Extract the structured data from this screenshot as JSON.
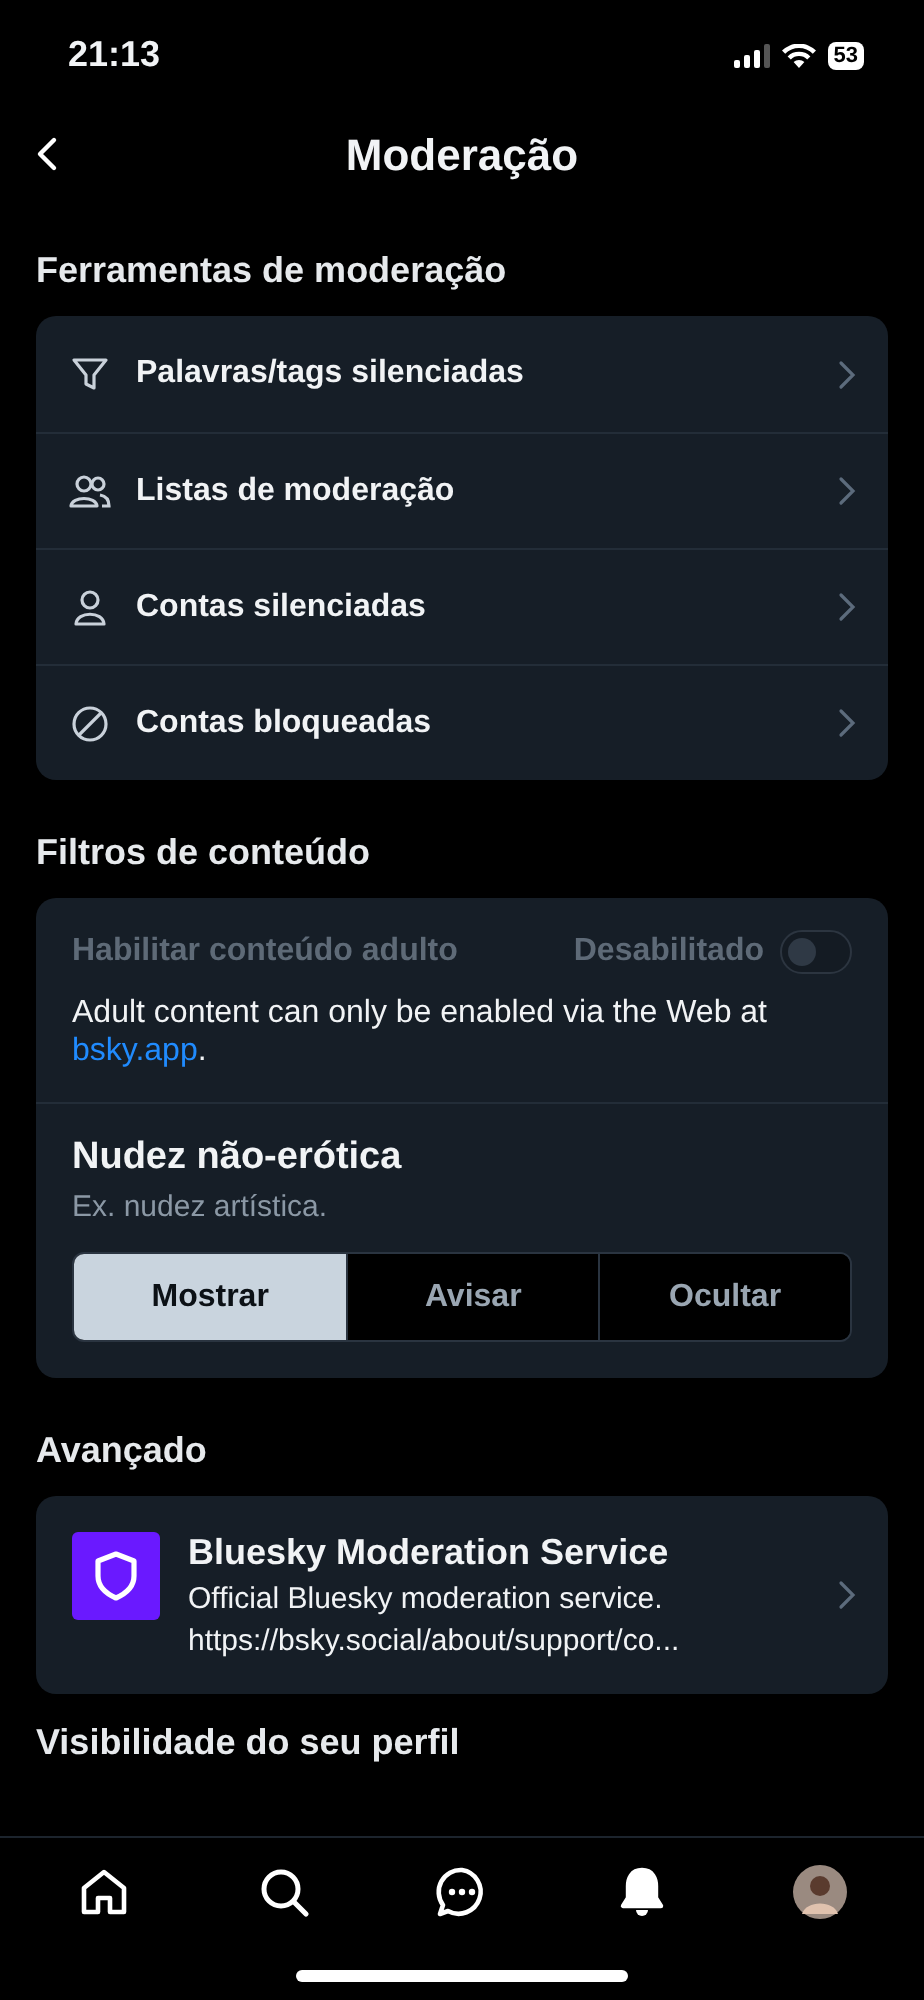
{
  "status_bar": {
    "time": "21:13",
    "battery": "53"
  },
  "header": {
    "title": "Moderação"
  },
  "tools": {
    "heading": "Ferramentas de moderação",
    "items": [
      {
        "kind": "filter",
        "label": "Palavras/tags silenciadas"
      },
      {
        "kind": "people",
        "label": "Listas de moderação"
      },
      {
        "kind": "person",
        "label": "Contas silenciadas"
      },
      {
        "kind": "blocked",
        "label": "Contas bloqueadas"
      }
    ]
  },
  "content_filters": {
    "heading": "Filtros de conteúdo",
    "adult": {
      "label": "Habilitar conteúdo adulto",
      "state_text": "Desabilitado",
      "on": false,
      "disabled": true
    },
    "notice": "Adult content can only be enabled via the Web at ",
    "notice_link": "bsky.app",
    "notice_end": ".",
    "nudity": {
      "title": "Nudez não-erótica",
      "subtitle": "Ex. nudez artística.",
      "options": [
        {
          "label": "Mostrar",
          "selected": true
        },
        {
          "label": "Avisar",
          "selected": false
        },
        {
          "label": "Ocultar",
          "selected": false
        }
      ]
    }
  },
  "advanced": {
    "heading": "Avançado",
    "service": {
      "name": "Bluesky Moderation Service",
      "description": "Official Bluesky moderation service.",
      "url": "https://bsky.social/about/support/co..."
    }
  },
  "next_heading": "Visibilidade do seu perfil",
  "tab_bar": [
    {
      "kind": "home",
      "selected": false
    },
    {
      "kind": "search",
      "selected": false
    },
    {
      "kind": "chat",
      "selected": false
    },
    {
      "kind": "bell",
      "selected": true
    },
    {
      "kind": "avatar",
      "selected": false
    }
  ]
}
